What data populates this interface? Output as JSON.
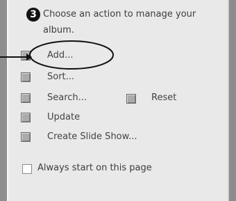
{
  "step_number": "3",
  "heading": "Choose an action to manage your album.",
  "actions": [
    {
      "label": "Add..."
    },
    {
      "label": "Sort..."
    },
    {
      "label": "Search..."
    },
    {
      "label": "Update"
    },
    {
      "label": "Create Slide Show..."
    }
  ],
  "reset_label": "Reset",
  "always_start_label": "Always start on this page",
  "always_start_checked": false,
  "highlight": {
    "target": "Add...",
    "style": "hand-drawn oval with arrow"
  }
}
